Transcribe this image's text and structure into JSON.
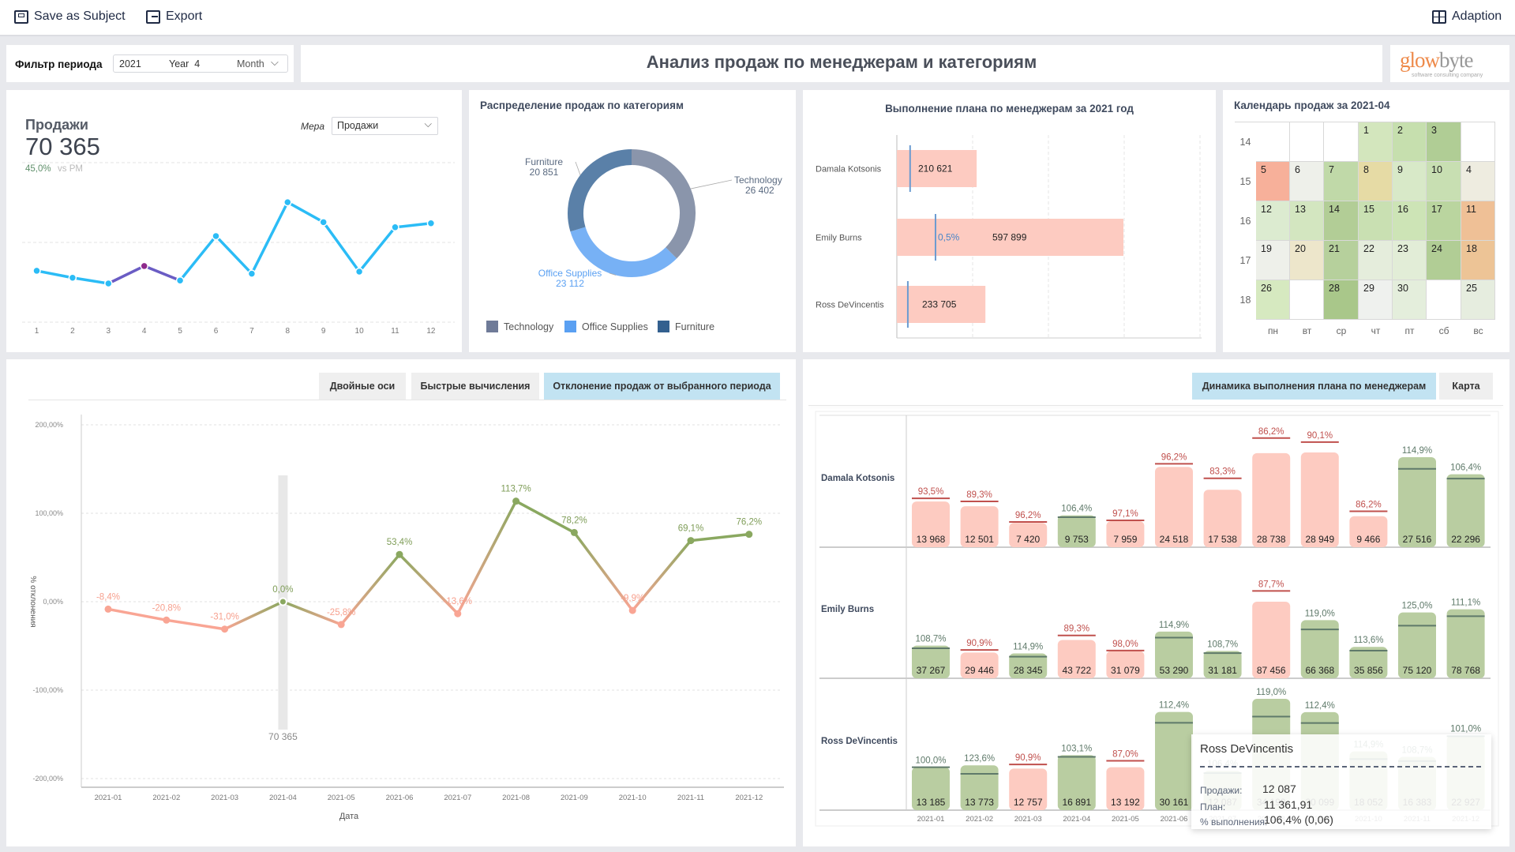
{
  "toolbar": {
    "save_label": "Save as Subject",
    "export_label": "Export",
    "adaption_label": "Adaption"
  },
  "filter": {
    "label": "Фильтр периода",
    "year": "2021",
    "period": "Year  4",
    "granularity": "Month"
  },
  "header": {
    "title": "Анализ продаж по менеджерам и категориям",
    "logo_text": "glowbyte",
    "logo_tagline": "software consulting company"
  },
  "sales_card": {
    "title": "Продажи",
    "value": "70 365",
    "change": "45,0%",
    "change_suffix": "vs PM",
    "measure_label": "Мера",
    "measure_value": "Продажи",
    "change_color": "#5f8f6a"
  },
  "left_tabs": [
    {
      "label": "Двойные оси",
      "active": false
    },
    {
      "label": "Быстрые вычисления",
      "active": false
    },
    {
      "label": "Отклонение продаж от выбранного периода",
      "active": true
    }
  ],
  "right_tabs": [
    {
      "label": "Динамика выполнения плана по менеджерам",
      "active": true
    },
    {
      "label": "Карта",
      "active": false
    }
  ],
  "chart_data": [
    {
      "id": "sales_trend",
      "type": "line",
      "x": [
        "1",
        "2",
        "3",
        "4",
        "5",
        "6",
        "7",
        "8",
        "9",
        "10",
        "11",
        "12"
      ],
      "values": [
        64420,
        55720,
        48522,
        70366,
        52230,
        107969,
        60806,
        150393,
        125416,
        63374,
        119019,
        123991
      ],
      "ylim": [
        0,
        200000
      ],
      "grid": true,
      "highlighted_index": 3,
      "colors": {
        "line": "#2bbcf6",
        "highlight": "#8e2a8c"
      }
    },
    {
      "id": "category_donut",
      "type": "pie",
      "title": "Распределение продаж по категориям",
      "categories": [
        "Technology",
        "Office Supplies",
        "Furniture"
      ],
      "values": [
        26402,
        23112,
        20851
      ],
      "value_labels": [
        "26 402",
        "23 112",
        "20 851"
      ],
      "colors": [
        "#8a95ab",
        "#77b1f5",
        "#5a80a8"
      ],
      "legend_colors": [
        "#6f7b98",
        "#5aa0f2",
        "#33608f"
      ],
      "legend": "bottom"
    },
    {
      "id": "plan_by_manager",
      "type": "bar",
      "title": "Выполнение плана по менеджерам за 2021 год",
      "categories": [
        "Damala Kotsonis",
        "Emily Burns",
        "Ross DeVincentis"
      ],
      "values": [
        210621,
        597899,
        233705
      ],
      "value_labels": [
        "210 621",
        "597 899",
        "233 705"
      ],
      "markers": [
        35000,
        102000,
        29000
      ],
      "marker_label": "0,5%",
      "grid": true,
      "bar_color": "#fdcbc1",
      "marker_color": "#6a9bd1"
    },
    {
      "id": "sales_calendar",
      "type": "heatmap",
      "title": "Календарь продаж за 2021-04",
      "weeks": [
        "14",
        "15",
        "16",
        "17",
        "18"
      ],
      "weekdays": [
        "пн",
        "вт",
        "ср",
        "чт",
        "пт",
        "сб",
        "вс"
      ],
      "cells": [
        [
          null,
          null,
          null,
          {
            "d": "1",
            "c": "#d3e6bd"
          },
          {
            "d": "2",
            "c": "#c6dfae"
          },
          {
            "d": "3",
            "c": "#b0cd95"
          },
          null
        ],
        [
          {
            "d": "5",
            "c": "#f7b09a"
          },
          {
            "d": "6",
            "c": "#eef0ea"
          },
          {
            "d": "7",
            "c": "#c0d9a8"
          },
          {
            "d": "8",
            "c": "#e6dba5"
          },
          {
            "d": "9",
            "c": "#d8e9c8"
          },
          {
            "d": "10",
            "c": "#c8dfb2"
          },
          {
            "d": "4",
            "c": "#eeece0"
          }
        ],
        [
          {
            "d": "12",
            "c": "#dcebd0"
          },
          {
            "d": "13",
            "c": "#d3e6c0"
          },
          {
            "d": "14",
            "c": "#b2cd96"
          },
          {
            "d": "15",
            "c": "#c9e0b2"
          },
          {
            "d": "16",
            "c": "#cde4b6"
          },
          {
            "d": "17",
            "c": "#bad59f"
          },
          {
            "d": "11",
            "c": "#efc096"
          }
        ],
        [
          {
            "d": "19",
            "c": "#eef0ea"
          },
          {
            "d": "20",
            "c": "#ede6cb"
          },
          {
            "d": "21",
            "c": "#b6d09c"
          },
          {
            "d": "22",
            "c": "#e5eddc"
          },
          {
            "d": "23",
            "c": "#e2edd7"
          },
          {
            "d": "24",
            "c": "#b1cd95"
          },
          {
            "d": "18",
            "c": "#edc496"
          }
        ],
        [
          {
            "d": "26",
            "c": "#d6e9c0"
          },
          null,
          {
            "d": "28",
            "c": "#a9c78a"
          },
          {
            "d": "29",
            "c": "#eff1ee"
          },
          {
            "d": "30",
            "c": "#e4eedc"
          },
          null,
          {
            "d": "25",
            "c": "#e6eddf"
          }
        ]
      ]
    },
    {
      "id": "sales_deviation",
      "type": "line",
      "x": [
        "2021-01",
        "2021-02",
        "2021-03",
        "2021-04",
        "2021-05",
        "2021-06",
        "2021-07",
        "2021-08",
        "2021-09",
        "2021-10",
        "2021-11",
        "2021-12"
      ],
      "values": [
        -8.4,
        -20.8,
        -31.0,
        0.0,
        -25.8,
        53.4,
        -13.6,
        113.7,
        78.2,
        -9.9,
        69.1,
        76.2
      ],
      "value_labels": [
        "-8,4%",
        "-20,8%",
        "-31,0%",
        "0,0%",
        "-25,8%",
        "53,4%",
        "-13,6%",
        "113,7%",
        "78,2%",
        "-9,9%",
        "69,1%",
        "76,2%"
      ],
      "yticks": [
        200,
        100,
        0,
        -100,
        -200
      ],
      "ytick_labels": [
        "200,00%",
        "100,00%",
        "0,00%",
        "-100,00%",
        "-200,00%"
      ],
      "ylim": [
        -200,
        200
      ],
      "xlabel": "Дата",
      "ylabel": "% отклонения",
      "selected_index": 3,
      "selected_label": "70 365",
      "grid": true,
      "colors": {
        "negative": "#f9a594",
        "positive": "#8aa860"
      }
    },
    {
      "id": "plan_dynamics",
      "type": "bar",
      "categories": [
        "2021-01",
        "2021-02",
        "2021-03",
        "2021-04",
        "2021-05",
        "2021-06",
        "2021-07",
        "2021-08",
        "2021-09",
        "2021-10",
        "2021-11",
        "2021-12"
      ],
      "series": [
        {
          "name": "Damala Kotsonis",
          "values": [
            13968,
            12501,
            7420,
            9753,
            7959,
            24518,
            17538,
            28738,
            28949,
            9466,
            27516,
            22296
          ],
          "value_labels": [
            "13 968",
            "12 501",
            "7 420",
            "9 753",
            "7 959",
            "24 518",
            "17 538",
            "28 738",
            "28 949",
            "9 466",
            "27 516",
            "22 296"
          ],
          "pct": [
            93.5,
            89.3,
            96.2,
            106.4,
            97.1,
            96.2,
            83.3,
            86.2,
            90.1,
            86.2,
            114.9,
            106.4
          ],
          "pct_labels": [
            "93,5%",
            "89,3%",
            "96,2%",
            "106,4%",
            "97,1%",
            "96,2%",
            "83,3%",
            "86,2%",
            "90,1%",
            "86,2%",
            "114,9%",
            "106,4%"
          ]
        },
        {
          "name": "Emily Burns",
          "values": [
            37267,
            29446,
            28345,
            43722,
            31079,
            53290,
            31181,
            87456,
            66368,
            35856,
            75120,
            78768
          ],
          "value_labels": [
            "37 267",
            "29 446",
            "28 345",
            "43 722",
            "31 079",
            "53 290",
            "31 181",
            "87 456",
            "66 368",
            "35 856",
            "75 120",
            "78 768"
          ],
          "pct": [
            108.7,
            90.9,
            114.9,
            89.3,
            98.0,
            114.9,
            108.7,
            87.7,
            119.0,
            113.6,
            125.0,
            111.1
          ],
          "pct_labels": [
            "108,7%",
            "90,9%",
            "114,9%",
            "89,3%",
            "98,0%",
            "114,9%",
            "108,7%",
            "87,7%",
            "119,0%",
            "113,6%",
            "125,0%",
            "111,1%"
          ]
        },
        {
          "name": "Ross DeVincentis",
          "values": [
            13185,
            13773,
            12757,
            16891,
            13192,
            30161,
            12087,
            34199,
            30099,
            18052,
            16383,
            22927
          ],
          "value_labels": [
            "13 185",
            "13 773",
            "12 757",
            "16 891",
            "13 192",
            "30 161",
            "12 087",
            "34 199",
            "30 099",
            "18 052",
            "16 383",
            "22 927"
          ],
          "pct": [
            100.0,
            123.6,
            90.9,
            103.1,
            87.0,
            112.4,
            106.4,
            119.0,
            112.4,
            114.9,
            108.7,
            101.0
          ],
          "pct_labels": [
            "100,0%",
            "123,6%",
            "90,9%",
            "103,1%",
            "87,0%",
            "112,4%",
            "106,4%",
            "119,0%",
            "112,4%",
            "114,9%",
            "108,7%",
            "101,0%"
          ]
        }
      ],
      "colors": {
        "over_bar": "#b9cda1",
        "under_bar": "#fdcbc1",
        "over_label": "#5f7a6a",
        "under_label": "#c0504d"
      }
    }
  ],
  "tooltip": {
    "title": "Ross DeVincentis",
    "sales_label": "Продажи:",
    "sales_value": "12 087",
    "plan_label": "План:",
    "plan_value": "11 361,91",
    "pct_label": "% выполнения:",
    "pct_value": "106,4% (0,06)"
  }
}
